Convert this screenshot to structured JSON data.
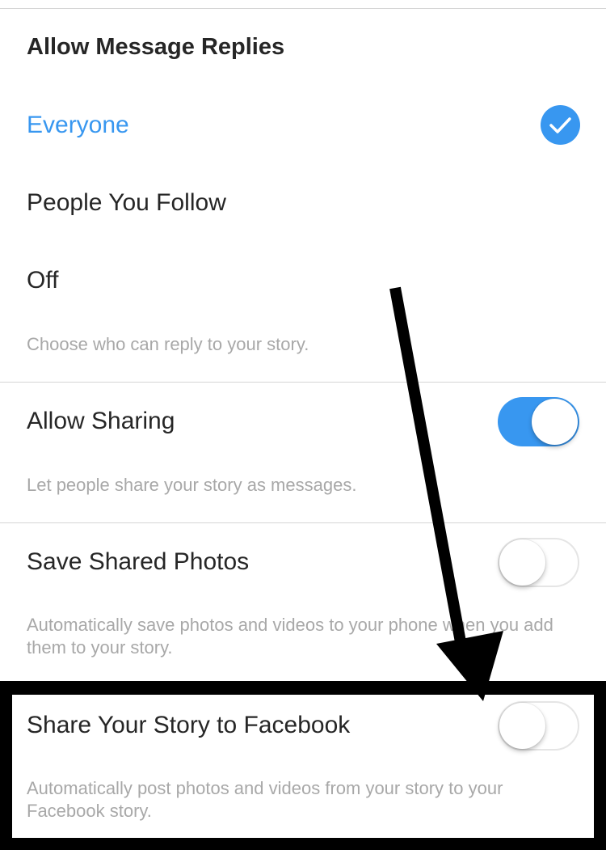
{
  "message_replies": {
    "title": "Allow Message Replies",
    "options": [
      {
        "label": "Everyone",
        "selected": true
      },
      {
        "label": "People You Follow",
        "selected": false
      },
      {
        "label": "Off",
        "selected": false
      }
    ],
    "helper": "Choose who can reply to your story."
  },
  "allow_sharing": {
    "label": "Allow Sharing",
    "enabled": true,
    "helper": "Let people share your story as messages."
  },
  "save_shared_photos": {
    "label": "Save Shared Photos",
    "enabled": false,
    "helper": "Automatically save photos and videos to your phone when you add them to your story."
  },
  "share_to_facebook": {
    "label": "Share Your Story to Facebook",
    "enabled": false,
    "helper": "Automatically post photos and videos from your story to your Facebook story."
  },
  "colors": {
    "accent": "#3897f0",
    "primary_text": "#262626",
    "secondary_text": "#a8a8a8",
    "separator": "#d6d6d6",
    "annotation": "#000000"
  },
  "icons": {
    "selected_check": "checkmark-icon",
    "annotation_arrow": "arrow-down-icon"
  }
}
